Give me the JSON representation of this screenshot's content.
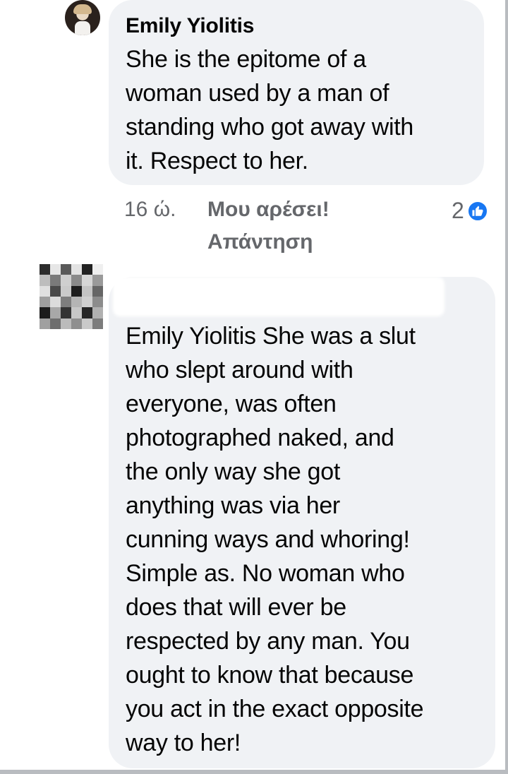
{
  "comment1": {
    "author": "Emily Yiolitis",
    "text_lines": [
      "She is the epitome of a",
      "woman used by a man of",
      "standing who got away with",
      "it. Respect to her."
    ],
    "time": "16 ώ.",
    "like_label": "Μου αρέσει!",
    "reply_label": "Απάντηση",
    "reaction_count": "2",
    "reaction_icon": "thumbs-up-icon"
  },
  "comment2": {
    "author_redacted": true,
    "text_lines": [
      "Emily Yiolitis She was a slut",
      "who slept around with",
      "everyone, was often",
      "photographed naked, and",
      "the only way she got",
      "anything was via her",
      "cunning ways and whoring!",
      "Simple as. No woman who",
      "does that will ever be",
      "respected by any man. You",
      "ought to know that because",
      "you act in the exact opposite",
      "way to her!"
    ]
  },
  "colors": {
    "bubble": "#f0f2f5",
    "meta_text": "#65676b",
    "accent": "#1877f2"
  }
}
